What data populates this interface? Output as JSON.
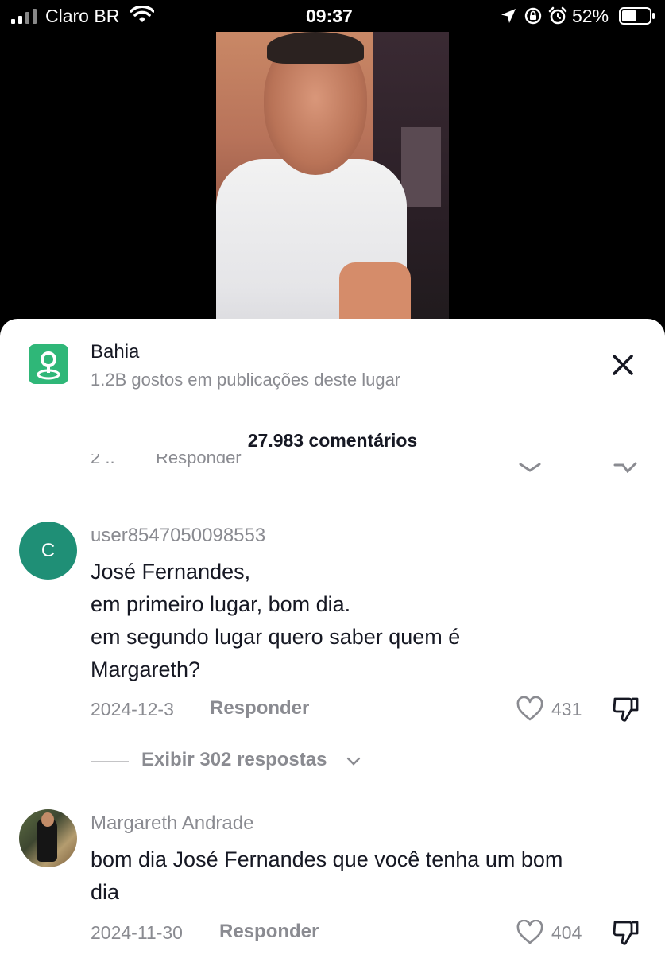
{
  "status_bar": {
    "carrier": "Claro BR",
    "time": "09:37",
    "battery_percent": "52%",
    "icons": [
      "signal-icon",
      "wifi-icon",
      "location-arrow-icon",
      "orientation-lock-icon",
      "alarm-icon",
      "battery-icon"
    ]
  },
  "place": {
    "name": "Bahia",
    "subtitle": "1.2B gostos em publicações deste lugar",
    "icon": "location-pin-icon",
    "accent_color": "#2fb778"
  },
  "comments_header": {
    "count_label": "27.983 comentários"
  },
  "partial_row": {
    "date": "2 ..",
    "reply_label": "Responder"
  },
  "comments": [
    {
      "avatar_letter": "C",
      "avatar_color": "#1f8f76",
      "username": "user8547050098553",
      "text": "José Fernandes,\nem primeiro lugar, bom dia.\nem segundo lugar quero saber quem é\nMargareth?",
      "date": "2024-12-3",
      "reply_label": "Responder",
      "likes": "431",
      "view_replies": "Exibir 302 respostas"
    },
    {
      "avatar_letter": "",
      "username": "Margareth Andrade",
      "text": "bom dia José Fernandes que você tenha um bom\ndia",
      "date": "2024-11-30",
      "reply_label": "Responder",
      "likes": "404"
    }
  ]
}
